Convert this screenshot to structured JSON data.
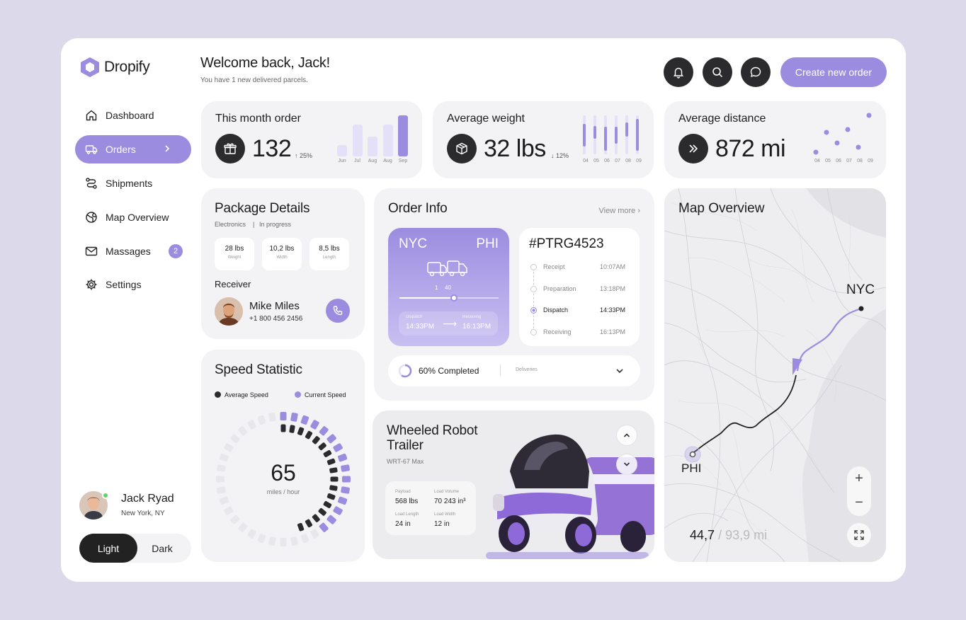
{
  "app": {
    "name": "Dropify",
    "accent": "#9c8ce0",
    "dark": "#2b2b2d"
  },
  "sidebar": {
    "items": [
      {
        "label": "Dashboard",
        "icon": "home-icon"
      },
      {
        "label": "Orders",
        "icon": "truck-icon",
        "active": true
      },
      {
        "label": "Shipments",
        "icon": "route-icon"
      },
      {
        "label": "Map Overview",
        "icon": "globe-icon"
      },
      {
        "label": "Massages",
        "icon": "mail-icon",
        "badge": "2"
      },
      {
        "label": "Settings",
        "icon": "gear-icon"
      }
    ],
    "user": {
      "name": "Jack Ryad",
      "location": "New York, NY"
    },
    "theme": {
      "light": "Light",
      "dark": "Dark",
      "selected": "Light"
    }
  },
  "header": {
    "welcome": "Welcome back, Jack!",
    "subtitle": "You have 1 new delivered parcels.",
    "create_label": "Create new order"
  },
  "stats": {
    "orders": {
      "title": "This month order",
      "value": "132",
      "change": "25%",
      "direction": "up",
      "months": [
        "Jun",
        "Jul",
        "Aug",
        "Aug",
        "Sep"
      ],
      "bar_levels": [
        0.28,
        0.78,
        0.48,
        0.78,
        1.0
      ]
    },
    "weight": {
      "title": "Average weight",
      "value": "32 lbs",
      "change": "12%",
      "direction": "down",
      "days": [
        "04",
        "05",
        "06",
        "07",
        "08",
        "09"
      ]
    },
    "distance": {
      "title": "Average distance",
      "value": "872 mi",
      "days": [
        "04",
        "05",
        "06",
        "07",
        "08",
        "09"
      ]
    }
  },
  "package": {
    "title": "Package Details",
    "category": "Electronics",
    "status": "In progress",
    "dims": [
      {
        "value": "28 lbs",
        "label": "Weight"
      },
      {
        "value": "10,2 lbs",
        "label": "Width"
      },
      {
        "value": "8,5 lbs",
        "label": "Length"
      }
    ],
    "receiver_label": "Receiver",
    "receiver": {
      "name": "Mike Miles",
      "phone": "+1 800 456 2456"
    }
  },
  "order": {
    "title": "Order Info",
    "view_more": "View more",
    "from": "NYC",
    "to": "PHI",
    "progress_labels": [
      "1",
      "40"
    ],
    "dispatch_label": "Dispatch",
    "dispatch_time": "14:33PM",
    "receiving_label": "Receiving",
    "receiving_time": "16:13PM",
    "id": "#PTRG4523",
    "timeline": [
      {
        "step": "Receipt",
        "time": "10:07AM"
      },
      {
        "step": "Preparation",
        "time": "13:18PM"
      },
      {
        "step": "Dispatch",
        "time": "14:33PM",
        "active": true
      },
      {
        "step": "Receiving",
        "time": "16:13PM"
      }
    ],
    "completed": "60% Completed",
    "completed_fraction": 0.6,
    "deliveries": "Deliveries"
  },
  "speed": {
    "title": "Speed Statistic",
    "legend": [
      "Average Speed",
      "Current Speed"
    ],
    "value": "65",
    "unit": "miles / hour"
  },
  "robot": {
    "title": "Wheeled Robot Trailer",
    "model": "WRT-67 Max",
    "specs": [
      {
        "label": "Payload",
        "value": "568 lbs"
      },
      {
        "label": "Load Volume",
        "value": "70 243 in³"
      },
      {
        "label": "Load Length",
        "value": "24 in"
      },
      {
        "label": "Load Width",
        "value": "12 in"
      }
    ]
  },
  "map": {
    "title": "Map Overview",
    "city_a": "NYC",
    "city_b": "PHI",
    "distance_done": "44,7",
    "distance_total": "/ 93,9 mi"
  }
}
